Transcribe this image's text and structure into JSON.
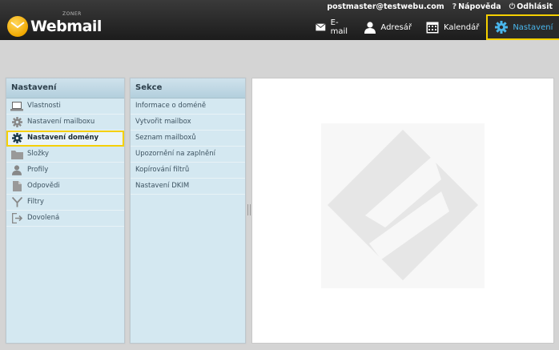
{
  "header": {
    "user_email": "postmaster@testwebu.com",
    "help_label": "Nápověda",
    "logout_label": "Odhlásit",
    "logo_text": "Webmail",
    "logo_brand": "ZONER",
    "nav": [
      {
        "label": "E-mail",
        "icon": "mail-icon"
      },
      {
        "label": "Adresář",
        "icon": "person-icon"
      },
      {
        "label": "Kalendář",
        "icon": "calendar-icon"
      },
      {
        "label": "Nastavení",
        "icon": "gear-icon",
        "active": true
      }
    ]
  },
  "sidebar": {
    "title": "Nastavení",
    "items": [
      {
        "label": "Vlastnosti",
        "icon": "laptop-icon"
      },
      {
        "label": "Nastavení mailboxu",
        "icon": "gear-icon"
      },
      {
        "label": "Nastavení domény",
        "icon": "gear-icon",
        "selected": true
      },
      {
        "label": "Složky",
        "icon": "folder-icon"
      },
      {
        "label": "Profily",
        "icon": "person-icon"
      },
      {
        "label": "Odpovědi",
        "icon": "document-icon"
      },
      {
        "label": "Filtry",
        "icon": "filter-icon"
      },
      {
        "label": "Dovolená",
        "icon": "exit-icon"
      }
    ]
  },
  "sections": {
    "title": "Sekce",
    "items": [
      {
        "label": "Informace o doméně"
      },
      {
        "label": "Vytvořit mailbox"
      },
      {
        "label": "Seznam mailboxů"
      },
      {
        "label": "Upozornění na zaplnění"
      },
      {
        "label": "Kopírování filtrů"
      },
      {
        "label": "Nastavení DKIM"
      }
    ]
  },
  "colors": {
    "accent_blue": "#49b6ec",
    "highlight_yellow": "#f5d000",
    "panel_bg": "#d4e8f1"
  }
}
